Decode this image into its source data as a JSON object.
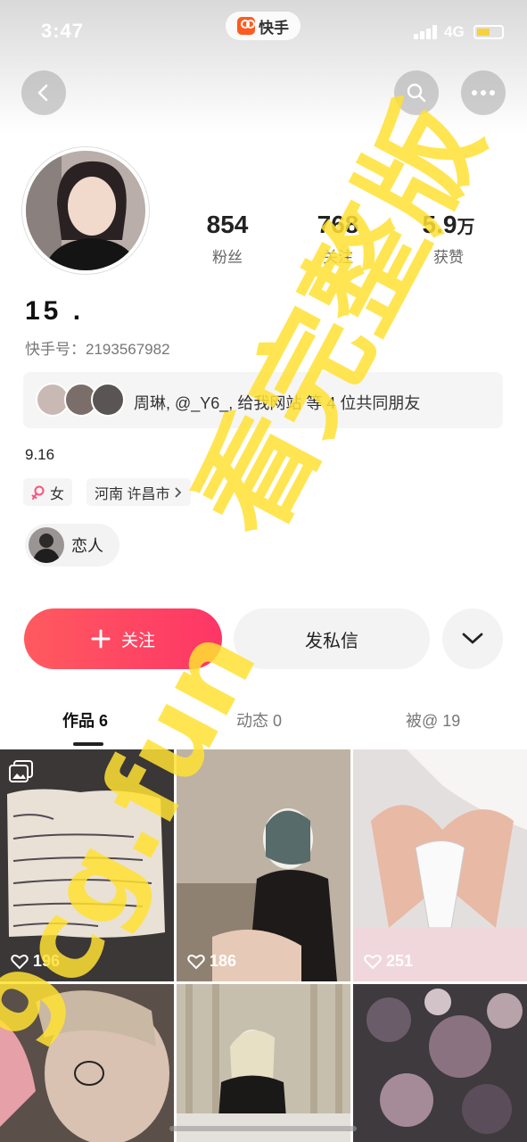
{
  "status_bar": {
    "time": "3:47",
    "network": "4G",
    "app_name": "快手"
  },
  "profile": {
    "username": "15 .",
    "user_id": "快手号：2193567982",
    "bio": "9.16",
    "stats": [
      {
        "value": "854",
        "unit": "",
        "label": "粉丝"
      },
      {
        "value": "768",
        "unit": "",
        "label": "关注"
      },
      {
        "value": "5.9",
        "unit": "万",
        "label": "获赞"
      }
    ],
    "mutual_friends_text": "周琳, @_Y6_, 给我网站 等 4 位共同朋友",
    "gender": "女",
    "location": "河南 许昌市",
    "relation": "恋人"
  },
  "actions": {
    "follow": "关注",
    "message": "发私信"
  },
  "tabs": [
    {
      "label": "作品",
      "count": "6"
    },
    {
      "label": "动态",
      "count": "0"
    },
    {
      "label": "被@",
      "count": "19"
    }
  ],
  "posts": [
    {
      "likes": "196",
      "icon": "album-icon"
    },
    {
      "likes": "186"
    },
    {
      "likes": "251"
    },
    {
      "likes": ""
    },
    {
      "likes": ""
    },
    {
      "likes": ""
    }
  ],
  "watermark": {
    "text1": "看完整版",
    "text2": "9cg.fun"
  },
  "colors": {
    "accent": "#fe3666",
    "watermark": "#ffe033"
  }
}
